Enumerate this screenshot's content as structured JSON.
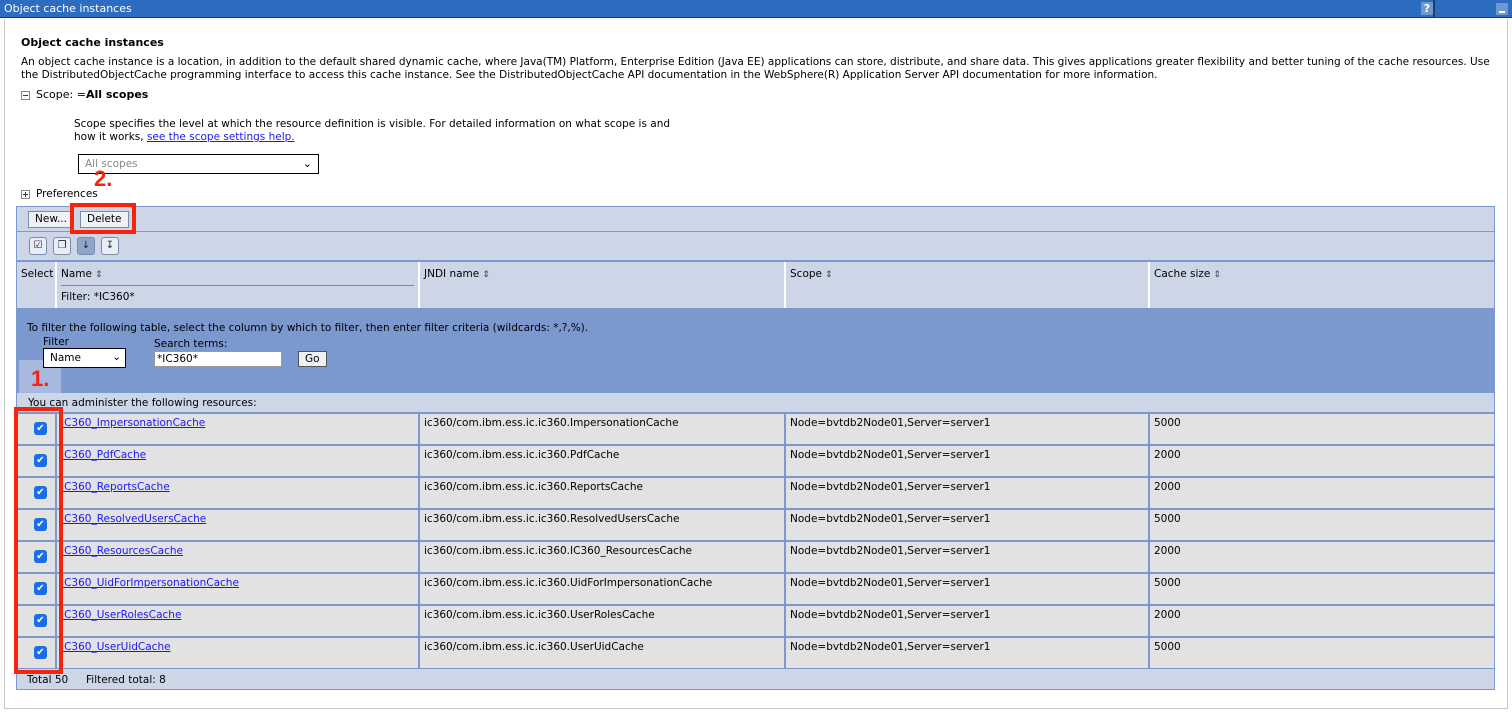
{
  "window": {
    "title": "Object cache instances",
    "help_icon": "help-icon",
    "minimize_icon": "minimize-icon"
  },
  "page": {
    "heading": "Object cache instances",
    "description": "An object cache instance is a location, in addition to the default shared dynamic cache, where Java(TM) Platform, Enterprise Edition (Java EE) applications can store, distribute, and share data. This gives applications greater flexibility and better tuning of the cache resources. Use the DistributedObjectCache programming interface to access this cache instance. See the DistributedObjectCache API documentation in the WebSphere(R) Application Server API documentation for more information.",
    "scope_label": "Scope: =",
    "scope_value": "All scopes",
    "scope_help_text": "Scope specifies the level at which the resource definition is visible. For detailed information on what scope is and how it works, ",
    "scope_help_link": "see the scope settings help.",
    "scope_select_value": "All scopes",
    "preferences_label": "Preferences"
  },
  "toolbar": {
    "new_label": "New...",
    "delete_label": "Delete",
    "icons": [
      "select-all-icon",
      "deselect-all-icon",
      "show-filter-icon",
      "clear-filter-icon"
    ]
  },
  "table": {
    "columns": [
      {
        "label": "Select"
      },
      {
        "label": "Name",
        "sort_icon": "◇"
      },
      {
        "label": "JNDI name",
        "sort_icon": "◇"
      },
      {
        "label": "Scope",
        "sort_icon": "◇"
      },
      {
        "label": "Cache size",
        "sort_icon": "◇"
      }
    ],
    "active_filter": "Filter: *IC360*",
    "filter_panel": {
      "intro": "To filter the following table, select the column by which to filter, then enter filter criteria (wildcards: *,?,%).",
      "filter_label": "Filter",
      "filter_select_value": "Name",
      "search_label": "Search terms:",
      "search_value": "*IC360*",
      "go_label": "Go"
    },
    "admin_text": "You can administer the following resources:",
    "rows": [
      {
        "checked": true,
        "name": "IC360_ImpersonationCache",
        "jndi": "ic360/com.ibm.ess.ic.ic360.ImpersonationCache",
        "scope": "Node=bvtdb2Node01,Server=server1",
        "size": "5000"
      },
      {
        "checked": true,
        "name": "IC360_PdfCache",
        "jndi": "ic360/com.ibm.ess.ic.ic360.PdfCache",
        "scope": "Node=bvtdb2Node01,Server=server1",
        "size": "2000"
      },
      {
        "checked": true,
        "name": "IC360_ReportsCache",
        "jndi": "ic360/com.ibm.ess.ic.ic360.ReportsCache",
        "scope": "Node=bvtdb2Node01,Server=server1",
        "size": "2000"
      },
      {
        "checked": true,
        "name": "IC360_ResolvedUsersCache",
        "jndi": "ic360/com.ibm.ess.ic.ic360.ResolvedUsersCache",
        "scope": "Node=bvtdb2Node01,Server=server1",
        "size": "5000"
      },
      {
        "checked": true,
        "name": "IC360_ResourcesCache",
        "jndi": "ic360/com.ibm.ess.ic.ic360.IC360_ResourcesCache",
        "scope": "Node=bvtdb2Node01,Server=server1",
        "size": "2000"
      },
      {
        "checked": true,
        "name": "IC360_UidForImpersonationCache",
        "jndi": "ic360/com.ibm.ess.ic.ic360.UidForImpersonationCache",
        "scope": "Node=bvtdb2Node01,Server=server1",
        "size": "5000"
      },
      {
        "checked": true,
        "name": "IC360_UserRolesCache",
        "jndi": "ic360/com.ibm.ess.ic.ic360.UserRolesCache",
        "scope": "Node=bvtdb2Node01,Server=server1",
        "size": "2000"
      },
      {
        "checked": true,
        "name": "IC360_UserUidCache",
        "jndi": "ic360/com.ibm.ess.ic.ic360.UserUidCache",
        "scope": "Node=bvtdb2Node01,Server=server1",
        "size": "5000"
      }
    ],
    "total": "Total 50",
    "filtered_total": "Filtered total: 8"
  },
  "annotations": {
    "step1": "1.",
    "step2": "2.",
    "color": "#f4250f"
  }
}
